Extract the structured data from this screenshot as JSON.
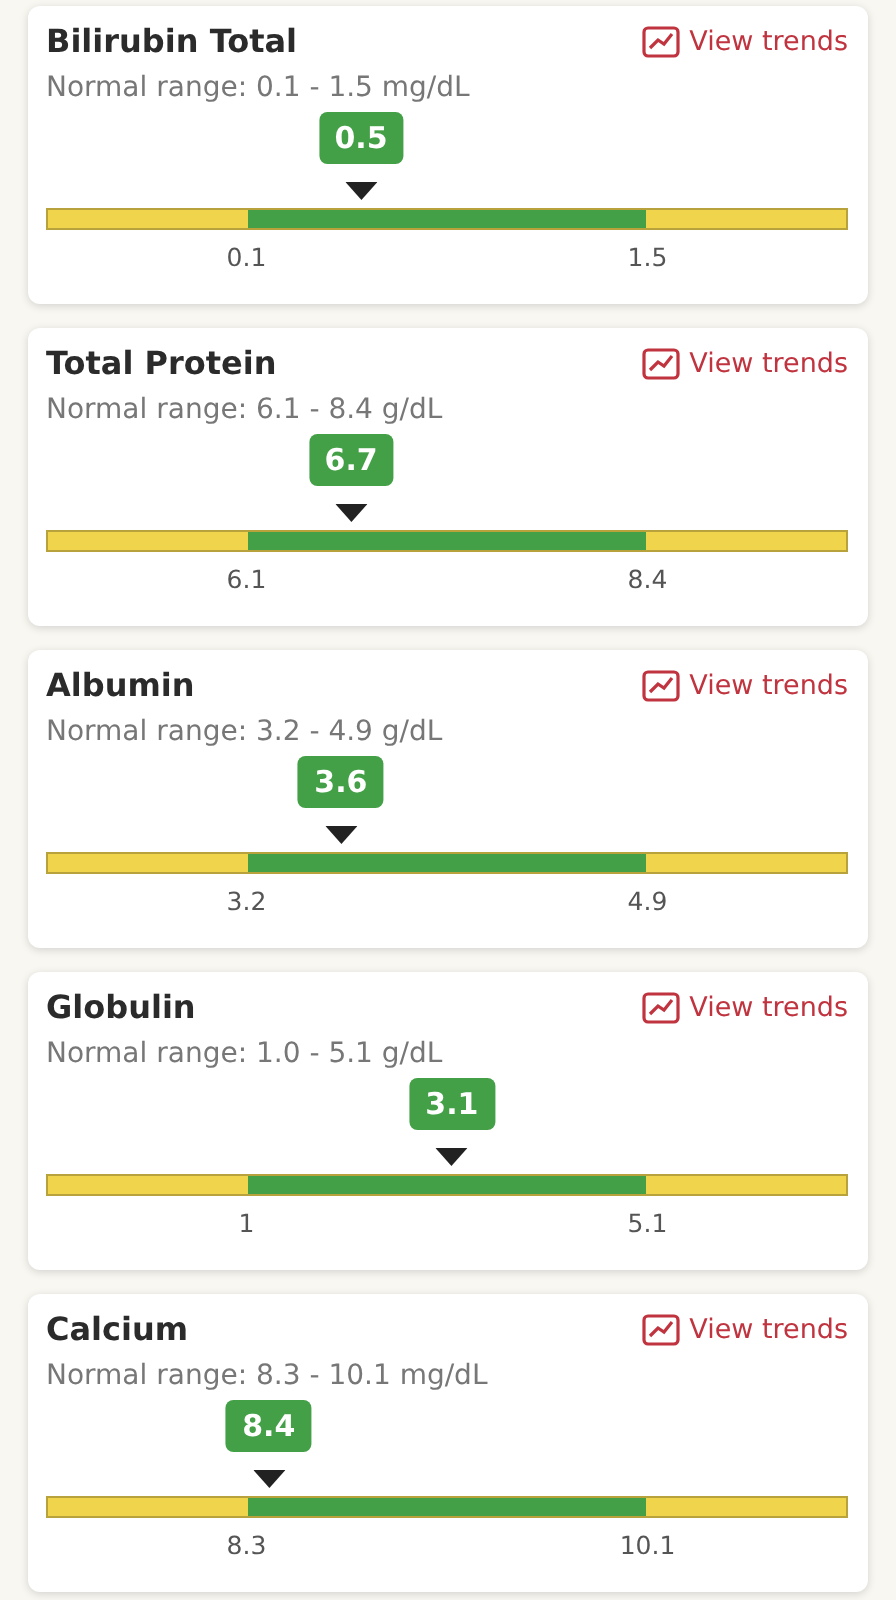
{
  "tests": [
    {
      "name": "Bilirubin Total",
      "link": "View trends",
      "range": "Normal range: 0.1 - 1.5 mg/dL",
      "value": "0.5",
      "low": "0.1",
      "high": "1.5"
    },
    {
      "name": "Total Protein",
      "link": "View trends",
      "range": "Normal range: 6.1 - 8.4 g/dL",
      "value": "6.7",
      "low": "6.1",
      "high": "8.4"
    },
    {
      "name": "Albumin",
      "link": "View trends",
      "range": "Normal range: 3.2 - 4.9 g/dL",
      "value": "3.6",
      "low": "3.2",
      "high": "4.9"
    },
    {
      "name": "Globulin",
      "link": "View trends",
      "range": "Normal range: 1.0 - 5.1 g/dL",
      "value": "3.1",
      "low": "1",
      "high": "5.1"
    },
    {
      "name": "Calcium",
      "link": "View trends",
      "range": "Normal range: 8.3 - 10.1 mg/dL",
      "value": "8.4",
      "low": "8.3",
      "high": "10.1"
    }
  ]
}
